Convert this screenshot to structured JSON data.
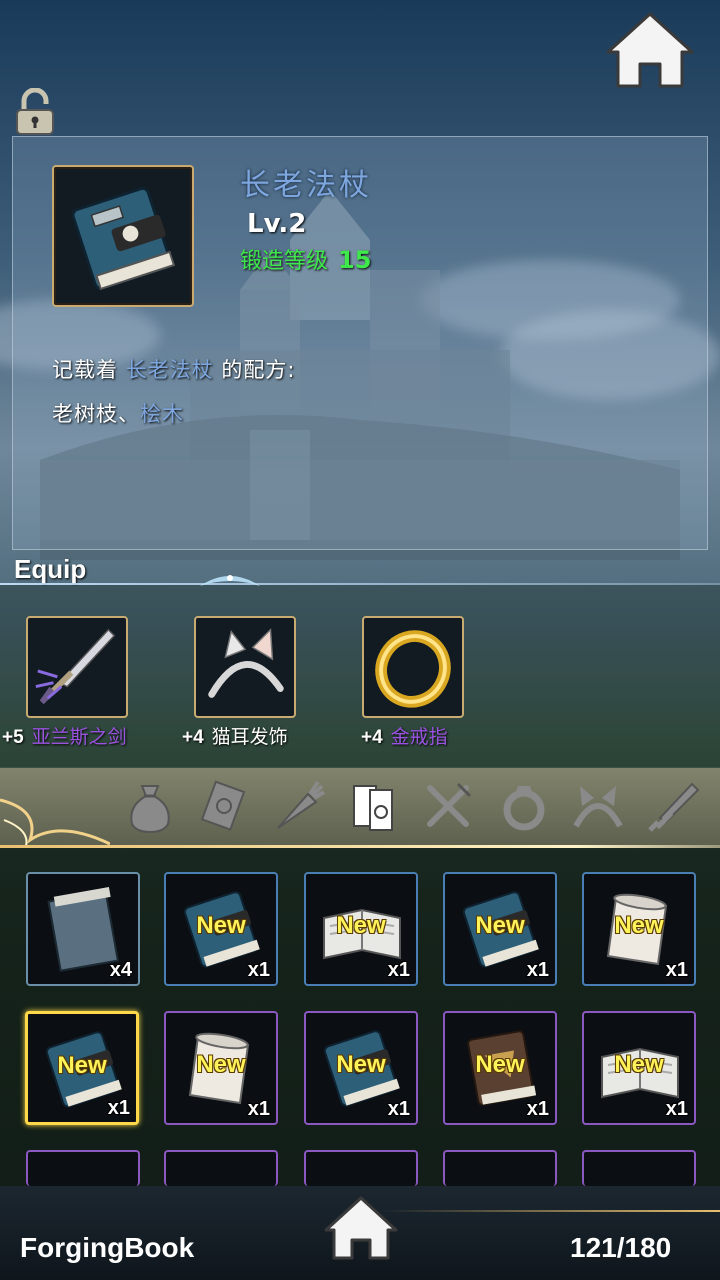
{
  "header": {
    "home_icon": "home-icon",
    "lock_icon": "unlock-icon"
  },
  "item": {
    "name": "长老法杖",
    "level": "Lv.2",
    "forge_label": "锻造等级",
    "forge_value": "15",
    "recipe_prefix": "记载着",
    "recipe_name": "长老法杖",
    "recipe_suffix": "的配方:",
    "ingredient_1": "老树枝、",
    "ingredient_2": "桧木"
  },
  "equip": {
    "label": "Equip",
    "slots": [
      {
        "plus": "+5",
        "name": "亚兰斯之剑",
        "color": "#9a52e0",
        "icon": "sword-icon"
      },
      {
        "plus": "+4",
        "name": "猫耳发饰",
        "color": "#ffffff",
        "icon": "cat-ear-headband-icon"
      },
      {
        "plus": "+4",
        "name": "金戒指",
        "color": "#9a52e0",
        "icon": "gold-ring-icon"
      }
    ]
  },
  "categories": [
    {
      "icon": "bag-icon",
      "active": false
    },
    {
      "icon": "card-icon",
      "active": false
    },
    {
      "icon": "carrot-icon",
      "active": false
    },
    {
      "icon": "books-icon",
      "active": true
    },
    {
      "icon": "fork-knife-icon",
      "active": false
    },
    {
      "icon": "ring-icon",
      "active": false
    },
    {
      "icon": "headband-icon",
      "active": false
    },
    {
      "icon": "sword-icon",
      "active": false
    }
  ],
  "inventory": {
    "rows": [
      [
        {
          "icon": "notebook-icon",
          "new": "",
          "count": "x4",
          "rarity": "bluegray"
        },
        {
          "icon": "book-icon",
          "new": "New",
          "count": "x1",
          "rarity": "blue"
        },
        {
          "icon": "open-book-icon",
          "new": "New",
          "count": "x1",
          "rarity": "blue"
        },
        {
          "icon": "book-icon",
          "new": "New",
          "count": "x1",
          "rarity": "blue"
        },
        {
          "icon": "scroll-icon",
          "new": "New",
          "count": "x1",
          "rarity": "blue"
        }
      ],
      [
        {
          "icon": "book-icon",
          "new": "New",
          "count": "x1",
          "rarity": "selected"
        },
        {
          "icon": "scroll-icon",
          "new": "New",
          "count": "x1",
          "rarity": "purple"
        },
        {
          "icon": "book-icon",
          "new": "New",
          "count": "x1",
          "rarity": "purple"
        },
        {
          "icon": "brown-book-icon",
          "new": "New",
          "count": "x1",
          "rarity": "purple"
        },
        {
          "icon": "open-book-icon",
          "new": "New",
          "count": "x1",
          "rarity": "purple"
        }
      ]
    ]
  },
  "footer": {
    "title": "ForgingBook",
    "count": "121/180",
    "home_icon": "home-icon"
  },
  "colors": {
    "accent_gold": "#c9ab72",
    "title_blue": "#7ea6de",
    "forge_green": "#3ee84a",
    "new_yellow": "#fff35a",
    "selected": "#ffd84a"
  }
}
